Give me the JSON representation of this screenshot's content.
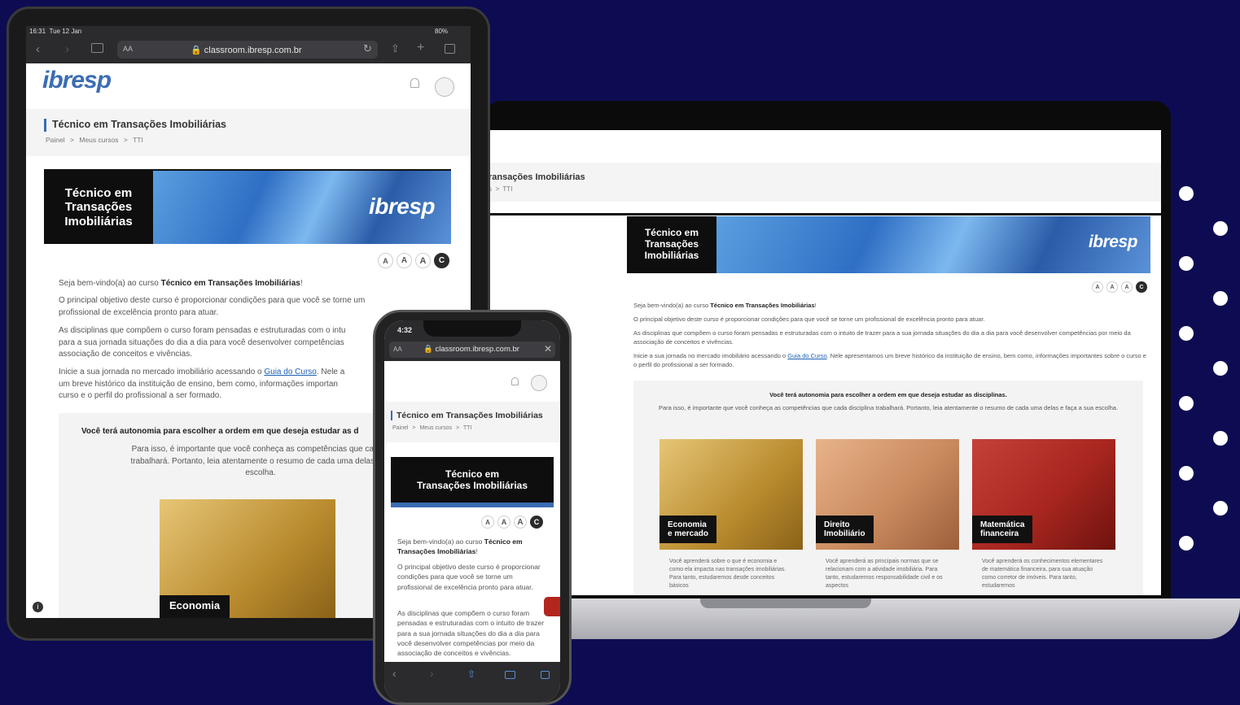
{
  "course_title": "Técnico em Transações Imobiliárias",
  "hero_title_lines": [
    "Técnico em",
    "Transações",
    "Imobiliárias"
  ],
  "phone_hero_lines": [
    "Técnico em",
    "Transações Imobiliárias"
  ],
  "laptop_title_partial": "ransações Imobiliárias",
  "laptop_breadcrumb_partial": "s  >  TTI",
  "brand": "ibresp",
  "breadcrumb": {
    "home": "Painel",
    "sep": ">",
    "courses": "Meus cursos",
    "current": "TTI"
  },
  "font_controls": [
    "A",
    "A",
    "A",
    "C"
  ],
  "browser": {
    "url": "classroom.ibresp.com.br",
    "aa": "AA"
  },
  "tablet_status": {
    "time": "16:31",
    "date": "Tue 12 Jan",
    "battery": "80%"
  },
  "phone_status": {
    "time": "4:32"
  },
  "content": {
    "welcome_pre": "Seja bem-vindo(a) ao curso ",
    "welcome_bold": "Técnico em Transações Imobiliárias",
    "welcome_post": "!",
    "objective": "O principal objetivo deste curso é proporcionar condições para que você se torne um profissional de excelência pronto para atuar.",
    "disciplines": "As disciplinas que compõem o curso foram pensadas e estruturadas com o intuito de trazer para a sua jornada situações do dia a dia para você desenvolver competências por meio da associação de conceitos e vivências.",
    "start_pre": "Inicie a sua jornada no mercado imobiliário acessando o ",
    "start_link": "Guia do Curso",
    "start_post": ". Nele apresentamos um breve histórico da instituição de ensino, bem como, informações importantes sobre o curso e o perfil do profissional a ser formado.",
    "autonomy": "Você terá autonomia para escolher a ordem em que deseja estudar as disciplinas.",
    "autonomy_detail": "Para isso, é importante que você conheça as competências que cada disciplina trabalhará. Portanto, leia atentamente o resumo de cada uma delas e faça a sua escolha."
  },
  "tablet_partial": {
    "objective_l1": "O principal objetivo deste curso é proporcionar condições para que você se torne um",
    "objective_l2": "profissional de excelência pronto para atuar.",
    "disc_l1": "As disciplinas que compõem o curso foram pensadas e estruturadas com o intu",
    "disc_l2": "para a sua jornada situações do dia a dia para você desenvolver competências",
    "disc_l3": "associação de conceitos e vivências.",
    "start_l1_pre": "Inicie a sua jornada no mercado imobiliário acessando o ",
    "start_l1_post": ". Nele a",
    "start_l2": "um breve histórico da instituição de ensino, bem como, informações importan",
    "start_l3": "curso e o perfil do profissional a ser formado.",
    "autonomy": "Você terá autonomia para escolher a ordem em que deseja estudar as d",
    "detail_l1": "Para isso, é importante que você conheça as competências que cada d",
    "detail_l2": "trabalhará. Portanto, leia atentamente o resumo de cada uma delas e fa",
    "detail_l3": "escolha."
  },
  "cards": [
    {
      "label_l1": "Economia",
      "label_l2": "e mercado",
      "desc": "Você aprenderá sobre o que é economia e como ela impacta nas transações imobiliárias. Para tanto, estudaremos desde conceitos básicos"
    },
    {
      "label_l1": "Direito",
      "label_l2": "Imobiliário",
      "desc": "Você aprenderá as principais normas que se relacionam com a atividade imobiliária. Para tanto, estudaremos responsabilidade civil e os aspectos"
    },
    {
      "label_l1": "Matemática",
      "label_l2": "financeira",
      "desc": "Você aprenderá os conhecimentos elementares de matemática financeira, para sua atuação como corretor de imóveis. Para tanto, estudaremos"
    }
  ],
  "tablet_card_label": "Economia",
  "colors": {
    "background": "#0d0c52",
    "accent": "#1a5fb4",
    "card_economia": "#c9a14a",
    "card_direito": "#c98a5e",
    "card_matematica": "#a8261f"
  }
}
